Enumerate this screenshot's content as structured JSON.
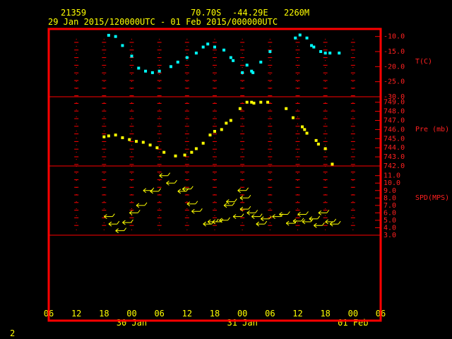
{
  "header": {
    "station": "21359",
    "lat": "70.70S",
    "lon": "-44.29E",
    "elev": "2260M",
    "period": "29 Jan 2015/120000UTC - 01 Feb 2015/000000UTC"
  },
  "footer": {
    "page_number": "2"
  },
  "colors": {
    "frame": "#ff0000",
    "temperature": "#00ffff",
    "pressure": "#ffff00",
    "wind": "#ffff00",
    "header": "#ffff00"
  },
  "chart_data": {
    "type": "scatter",
    "x_axis": {
      "unit": "hours from 29 Jan 2015 06 UTC",
      "range": [
        0,
        72
      ],
      "tick_labels": [
        "06",
        "12",
        "18",
        "00",
        "06",
        "12",
        "18",
        "00",
        "06",
        "12",
        "18",
        "00",
        "06"
      ],
      "date_labels": [
        {
          "label": "30 Jan",
          "x": 18
        },
        {
          "label": "31 Jan",
          "x": 42
        },
        {
          "label": "01 Feb",
          "x": 66
        }
      ]
    },
    "panels": [
      {
        "name": "T(C)",
        "ylim": [
          -30,
          -7
        ],
        "tick_labels": [
          "-10.0",
          "-15.0",
          "-20.0",
          "-25.0",
          "-30.0"
        ],
        "tick_values": [
          -10,
          -15,
          -20,
          -25,
          -30
        ],
        "series_color": "temperature",
        "points": [
          [
            13,
            -9.6
          ],
          [
            14.5,
            -10.0
          ],
          [
            16,
            -13.0
          ],
          [
            18,
            -16.5
          ],
          [
            19.5,
            -20.5
          ],
          [
            21,
            -21.5
          ],
          [
            22.5,
            -22.0
          ],
          [
            24,
            -21.5
          ],
          [
            26.5,
            -20.0
          ],
          [
            28,
            -18.5
          ],
          [
            30,
            -17.0
          ],
          [
            32,
            -15.5
          ],
          [
            33.5,
            -13.5
          ],
          [
            34.5,
            -12.5
          ],
          [
            36,
            -13.5
          ],
          [
            38,
            -14.5
          ],
          [
            39.5,
            -17.0
          ],
          [
            40,
            -18.0
          ],
          [
            42,
            -22.0
          ],
          [
            43,
            -19.5
          ],
          [
            44,
            -21.5
          ],
          [
            44.3,
            -22.0
          ],
          [
            46,
            -18.5
          ],
          [
            48,
            -15.0
          ],
          [
            53.5,
            -10.5
          ],
          [
            54.5,
            -9.5
          ],
          [
            56,
            -10.5
          ],
          [
            57,
            -13.0
          ],
          [
            57.5,
            -13.5
          ],
          [
            59,
            -15.0
          ],
          [
            60,
            -15.5
          ],
          [
            61,
            -15.5
          ],
          [
            63,
            -15.5
          ]
        ]
      },
      {
        "name": "Pre (mb)",
        "ylim": [
          742,
          750
        ],
        "tick_labels": [
          "749.0",
          "748.0",
          "747.0",
          "746.0",
          "745.0",
          "744.0",
          "743.0",
          "742.0"
        ],
        "tick_values": [
          749,
          748,
          747,
          746,
          745,
          744,
          743,
          742
        ],
        "series_color": "pressure",
        "points": [
          [
            12,
            745.2
          ],
          [
            13,
            745.3
          ],
          [
            14.5,
            745.4
          ],
          [
            16,
            745.1
          ],
          [
            17.5,
            744.9
          ],
          [
            19,
            744.7
          ],
          [
            20.5,
            744.6
          ],
          [
            22,
            744.3
          ],
          [
            23.5,
            744.0
          ],
          [
            25,
            743.5
          ],
          [
            27.5,
            743.1
          ],
          [
            29.5,
            743.2
          ],
          [
            31,
            743.5
          ],
          [
            32,
            743.9
          ],
          [
            33.5,
            744.5
          ],
          [
            35,
            745.4
          ],
          [
            36,
            745.8
          ],
          [
            37.5,
            746.0
          ],
          [
            38.5,
            746.7
          ],
          [
            39.5,
            747.0
          ],
          [
            41.5,
            748.3
          ],
          [
            43,
            749.0
          ],
          [
            44,
            749.0
          ],
          [
            44.5,
            748.9
          ],
          [
            46,
            749.0
          ],
          [
            47.5,
            749.0
          ],
          [
            51.5,
            748.3
          ],
          [
            53,
            747.3
          ],
          [
            55,
            746.3
          ],
          [
            55.5,
            746.0
          ],
          [
            56,
            745.6
          ],
          [
            58,
            744.8
          ],
          [
            58.5,
            744.4
          ],
          [
            60,
            743.9
          ],
          [
            61.5,
            742.2
          ]
        ]
      },
      {
        "name": "SPD(MPS)",
        "ylim": [
          3,
          12
        ],
        "tick_labels": [
          "11.0",
          "10.0",
          "9.0",
          "8.0",
          "7.0",
          "6.0",
          "5.0",
          "4.0",
          "3.0"
        ],
        "tick_values": [
          11,
          10,
          9,
          8,
          7,
          6,
          5,
          4,
          3
        ],
        "series_color": "wind",
        "points": [
          [
            12,
            5.5
          ],
          [
            13,
            4.5
          ],
          [
            14.5,
            3.6
          ],
          [
            16,
            4.7
          ],
          [
            17.5,
            6.0
          ],
          [
            19,
            7.0
          ],
          [
            20.5,
            9.0
          ],
          [
            22,
            8.9
          ],
          [
            24,
            11.0
          ],
          [
            25.5,
            10.0
          ],
          [
            28,
            8.9
          ],
          [
            29,
            9.2
          ],
          [
            30,
            7.2
          ],
          [
            31,
            6.2
          ],
          [
            33.5,
            4.5
          ],
          [
            34.5,
            4.8
          ],
          [
            35.5,
            4.8
          ],
          [
            37,
            5.0
          ],
          [
            38,
            7.0
          ],
          [
            38.5,
            7.5
          ],
          [
            40,
            5.5
          ],
          [
            41,
            9.0
          ],
          [
            41.5,
            8.0
          ],
          [
            41.5,
            6.5
          ],
          [
            43,
            6.0
          ],
          [
            44,
            5.5
          ],
          [
            45,
            4.5
          ],
          [
            46,
            5.2
          ],
          [
            48.5,
            5.5
          ],
          [
            50,
            5.8
          ],
          [
            51.5,
            4.6
          ],
          [
            53,
            4.9
          ],
          [
            54,
            5.8
          ],
          [
            55,
            4.8
          ],
          [
            56.5,
            5.2
          ],
          [
            57.5,
            4.3
          ],
          [
            58.5,
            6.0
          ],
          [
            60,
            4.8
          ],
          [
            61,
            4.5
          ]
        ]
      }
    ]
  }
}
